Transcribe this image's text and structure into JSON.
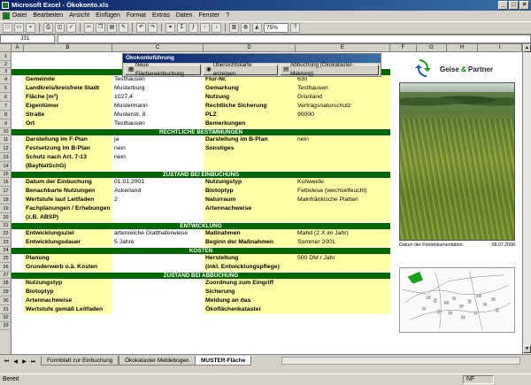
{
  "window": {
    "title": "Microsoft Excel - Ökokonto.xls",
    "buttons": [
      "_",
      "□",
      "×"
    ]
  },
  "menu": [
    "Datei",
    "Bearbeiten",
    "Ansicht",
    "Einfügen",
    "Format",
    "Extras",
    "Daten",
    "Fenster",
    "?"
  ],
  "toolbar": {
    "zoom": "75%"
  },
  "formula_bar": {
    "name_box": "J31",
    "formula": ""
  },
  "columns": [
    "A",
    "B",
    "C",
    "D",
    "E",
    "F",
    "G",
    "H",
    "I"
  ],
  "rows": [
    "1",
    "2",
    "3",
    "4",
    "5",
    "6",
    "7",
    "8",
    "9",
    "10",
    "11",
    "12",
    "13",
    "14",
    "15",
    "16",
    "17",
    "18",
    "19",
    "20",
    "21",
    "22",
    "23",
    "24",
    "25",
    "26",
    "27",
    "28",
    "29",
    "30",
    "31",
    "32",
    "33"
  ],
  "okokonto_panel": {
    "title": "Ökokontoführung",
    "buttons": [
      "Neue Flächeneinbuchung",
      "Übersichtskarte anzeigen",
      "Abbuchung (Ökokataster-Meldung)"
    ]
  },
  "logo": {
    "name_a": "Geise",
    "amp": "&",
    "name_b": "Partner"
  },
  "photo": {
    "caption_label": "Datum der Fotodokumentation:",
    "caption_date": "08.07.2000"
  },
  "sections": {
    "allgemein": "ALLGEMEINE ANGABEN",
    "rechtlich": "RECHTLICHE BESTIMMUNGEN",
    "zustand_ein": "ZUSTAND BEI EINBUCHUNG",
    "entwicklung": "ENTWICKLUNG",
    "kosten": "KOSTEN",
    "zustand_ab": "ZUSTAND BEI ABBUCHUNG"
  },
  "allgemein": [
    {
      "l1": "Gemeinde",
      "v1": "Testhausen",
      "l2": "Flur-Nr.",
      "v2": "630"
    },
    {
      "l1": "Landkreis/kreisfreie Stadt",
      "v1": "Musterburg",
      "l2": "Gemarkung",
      "v2": "Testhausen"
    },
    {
      "l1": "Fläche [m²]",
      "v1": "1027,4",
      "l2": "Nutzung",
      "v2": "Grünland"
    },
    {
      "l1": "Eigentümer",
      "v1": "Mustermann",
      "l2": "Rechtliche Sicherung",
      "v2": "Vertragsnaturschutz"
    },
    {
      "l1": "Straße",
      "v1": "Musterstr. 8",
      "l2": "PLZ",
      "v2": "90000"
    },
    {
      "l1": "Ort",
      "v1": "Testhausen",
      "l2": "Bemerkungen",
      "v2": ""
    }
  ],
  "rechtlich": [
    {
      "l1": "Darstellung im F-Plan",
      "v1": "ja",
      "l2": "Darstellung im B-Plan",
      "v2": "nein"
    },
    {
      "l1": "Festsetzung im B-Plan",
      "v1": "nein",
      "l2": "Sonstiges",
      "v2": ""
    },
    {
      "l1": "Schutz nach Art. 7-13",
      "v1": "nein",
      "l2": "",
      "v2": ""
    },
    {
      "l1": "(BayNatSchG)",
      "v1": "",
      "l2": "",
      "v2": ""
    }
  ],
  "zustand_ein": [
    {
      "l1": "Datum der Einbuchung",
      "v1": "01.01.2001",
      "l2": "Nutzungstyp",
      "v2": "Kuhweide"
    },
    {
      "l1": "Benachbarte Nutzungen",
      "v1": "Ackerland",
      "l2": "Biotoptyp",
      "v2": "Fettwiese (wechselfeucht)"
    },
    {
      "l1": "Wertstufe laut Leitfaden",
      "v1": "2",
      "l2": "Naturraum",
      "v2": "Mainfränkische Platten"
    },
    {
      "l1": "Fachplanungen / Erhebungen",
      "v1": "",
      "l2": "Artennachweise",
      "v2": ""
    },
    {
      "l1": "(z.B. ABSP)",
      "v1": "",
      "l2": "",
      "v2": ""
    }
  ],
  "entwicklung": [
    {
      "l1": "Entwicklungsziel",
      "v1": "artenreiche Glatthaferwiese",
      "l2": "Maßnahmen",
      "v2": "Mahd (2 X im Jahr)"
    },
    {
      "l1": "Entwicklungsdauer",
      "v1": "5 Jahre",
      "l2": "Beginn der Maßnahmen",
      "v2": "Sommer 2001"
    }
  ],
  "kosten": [
    {
      "l1": "Planung",
      "v1": "",
      "l2": "Herstellung",
      "v2": "500 DM / Jahr"
    },
    {
      "l1": "Grunderwerb o.ä. Kosten",
      "v1": "",
      "l2": "(inkl. Entwicklungspflege)",
      "v2": ""
    }
  ],
  "zustand_ab": [
    {
      "l1": "Nutzungstyp",
      "v1": "",
      "l2": "Zuordnung zum Eingriff",
      "v2": ""
    },
    {
      "l1": "Biotoptyp",
      "v1": "",
      "l2": "Sicherung",
      "v2": ""
    },
    {
      "l1": "Artennachweise",
      "v1": "",
      "l2": "Meldung an das",
      "v2": ""
    },
    {
      "l1": "Wertstufe gemäß Leitfaden",
      "v1": "",
      "l2": "Ökoflächenkataster",
      "v2": ""
    }
  ],
  "tabs": [
    "Formblatt zur Einbuchung",
    "Ökokataster Meldebogen",
    "MUSTER-Fläche"
  ],
  "status": {
    "left": "Bereit",
    "nf": "NF"
  },
  "colors": {
    "band": "#006600",
    "label_bg": "#ffffa8",
    "title_bar": "#0a246a"
  }
}
